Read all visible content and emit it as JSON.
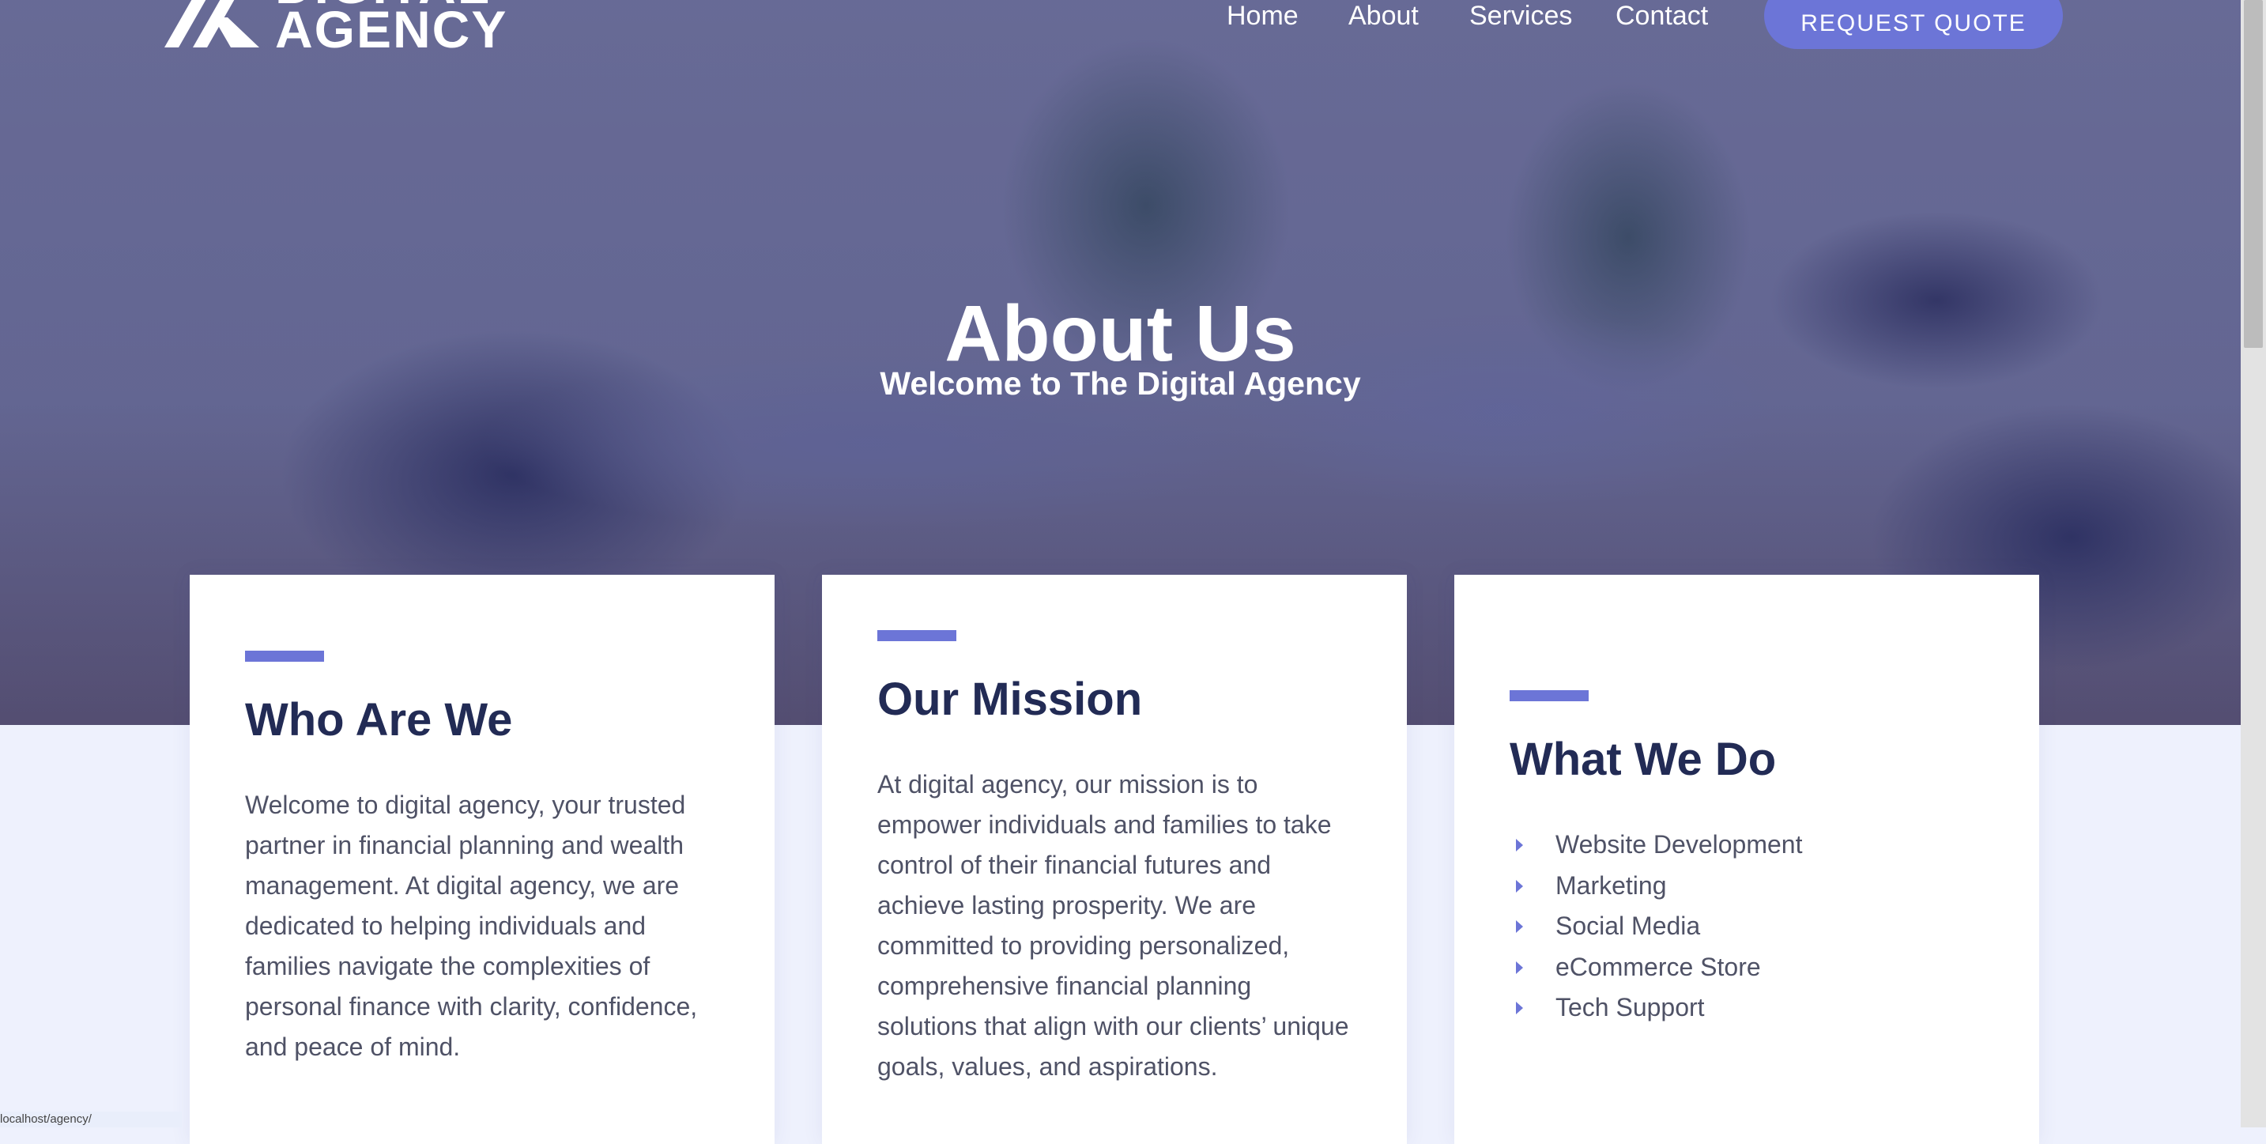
{
  "header": {
    "logo": {
      "line1": "DIGITAL",
      "line2": "AGENCY"
    },
    "nav": [
      "Home",
      "About",
      "Services",
      "Contact"
    ],
    "cta_label": "REQUEST QUOTE"
  },
  "hero": {
    "title": "About Us",
    "subtitle": "Welcome to The Digital Agency"
  },
  "cards": [
    {
      "title": "Who Are We",
      "body": "Welcome to digital agency, your trusted partner in financial planning and wealth management. At digital agency, we are dedicated to helping individuals and families navigate the complexities of personal finance with clarity, confidence, and peace of mind."
    },
    {
      "title": "Our Mission",
      "body": "At digital agency, our mission is to empower individuals and families to take control of their financial futures and achieve lasting prosperity. We are committed to providing personalized, comprehensive financial planning solutions that align with our clients’ unique goals, values, and aspirations."
    },
    {
      "title": "What We Do",
      "items": [
        "Website Development",
        "Marketing",
        "Social Media",
        "eCommerce Store",
        "Tech Support"
      ]
    }
  ],
  "status_url": "localhost/agency/",
  "colors": {
    "accent": "#6c75d7",
    "heading": "#222b55",
    "body_text": "#4f5266",
    "hero_overlay": "#363a78",
    "page_bg": "#eef1fd"
  }
}
